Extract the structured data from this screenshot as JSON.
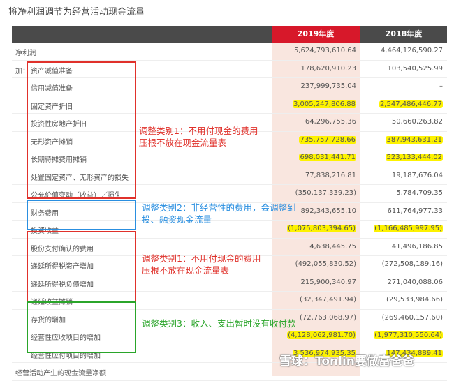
{
  "title": "将净利润调节为经营活动现金流量",
  "headers": {
    "y2019": "2019年度",
    "y2018": "2018年度"
  },
  "prefix_add": "加：",
  "rows": [
    {
      "label": "净利润",
      "v2019": "5,624,793,610.64",
      "v2018": "4,464,126,590.27",
      "hl": false
    },
    {
      "label": "资产减值准备",
      "v2019": "178,620,910.23",
      "v2018": "103,540,525.99",
      "hl": false
    },
    {
      "label": "信用减值准备",
      "v2019": "237,999,735.04",
      "v2018": "–",
      "hl": false
    },
    {
      "label": "固定资产折旧",
      "v2019": "3,005,247,806.88",
      "v2018": "2,547,486,446.77",
      "hl": true
    },
    {
      "label": "投资性房地产折旧",
      "v2019": "64,296,755.36",
      "v2018": "50,660,263.82",
      "hl": false
    },
    {
      "label": "无形资产摊销",
      "v2019": "735,757,728.66",
      "v2018": "387,943,631.21",
      "hl": true
    },
    {
      "label": "长期待摊费用摊销",
      "v2019": "698,031,441.71",
      "v2018": "523,133,444.02",
      "hl": true
    },
    {
      "label": "处置固定资产、无形资产的损失",
      "v2019": "77,838,216.81",
      "v2018": "19,187,676.04",
      "hl": false
    },
    {
      "label": "公允价值变动（收益）／损失",
      "v2019": "(350,137,339.23)",
      "v2018": "5,784,709.35",
      "hl": false
    },
    {
      "label": "财务费用",
      "v2019": "892,343,655.10",
      "v2018": "611,764,977.33",
      "hl": false
    },
    {
      "label": "投资收益",
      "v2019": "(1,075,803,394.65)",
      "v2018": "(1,166,485,997.95)",
      "hl": true
    },
    {
      "label": "股份支付确认的费用",
      "v2019": "4,638,445.75",
      "v2018": "41,496,186.85",
      "hl": false
    },
    {
      "label": "递延所得税资产增加",
      "v2019": "(492,055,830.52)",
      "v2018": "(272,508,189.16)",
      "hl": false
    },
    {
      "label": "递延所得税负债增加",
      "v2019": "215,900,340.97",
      "v2018": "271,040,088.06",
      "hl": false
    },
    {
      "label": "递延收益摊销",
      "v2019": "(32,347,491.94)",
      "v2018": "(29,533,984.66)",
      "hl": false
    },
    {
      "label": "存货的增加",
      "v2019": "(72,763,068.97)",
      "v2018": "(269,460,157.60)",
      "hl": false
    },
    {
      "label": "经营性应收项目的增加",
      "v2019": "(4,128,062,981.70)",
      "v2018": "(1,977,310,550.64)",
      "hl": true
    },
    {
      "label": "经营性应付项目的增加",
      "v2019": "3,536,974,935.35",
      "v2018": "147,434,889.41",
      "hl": true
    },
    {
      "label": "经营活动产生的现金流量净额",
      "v2019": "",
      "v2018": "",
      "hl": false
    }
  ],
  "notes": {
    "n1a": "调整类别1：不用付现金的费用",
    "n1b": "压根不放在现金流量表",
    "n2a": "调整类别2：非经营性的费用，会调整到",
    "n2b": "投、融资现金流量",
    "n3a": "调整类别1：不用付现金的费用",
    "n3b": "压根不放在现金流量表",
    "n4": "调整类别3：收入、支出暂时没有收付款"
  },
  "colors": {
    "red": "#e0312b",
    "blue": "#2a8fe0",
    "green": "#2aa52a",
    "highlight": "#fdf200"
  },
  "watermark": "雪球：Tonlin要做富爸爸"
}
